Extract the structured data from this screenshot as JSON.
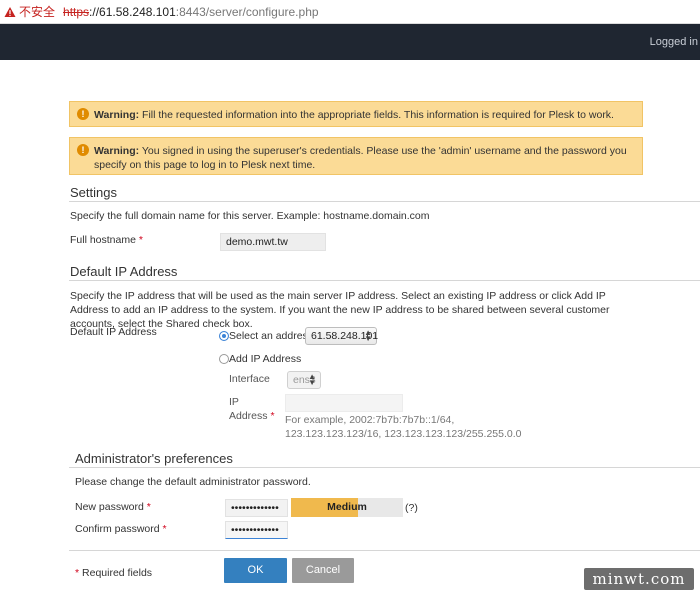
{
  "browser": {
    "insecure_label": "不安全",
    "url_scheme": "https",
    "url_host": "://61.58.248.101",
    "url_path": ":8443/server/configure.php"
  },
  "header": {
    "logged_in": "Logged in"
  },
  "warnings": [
    {
      "label": "Warning:",
      "text": " Fill the requested information into the appropriate fields. This information is required for Plesk to work."
    },
    {
      "label": "Warning:",
      "text": " You signed in using the superuser's credentials. Please use the 'admin' username and the password you specify on this page to log in to Plesk next time."
    }
  ],
  "settings": {
    "title": "Settings",
    "desc": "Specify the full domain name for this server. Example: hostname.domain.com",
    "hostname_label": "Full hostname",
    "hostname_value": "demo.mwt.tw",
    "required_mark": "*"
  },
  "ip": {
    "title": "Default IP Address",
    "desc": "Specify the IP address that will be used as the main server IP address. Select an existing IP address or click Add IP Address to add an IP address to the system. If you want the new IP address to be shared between several customer accounts, select the Shared check box.",
    "label": "Default IP Address",
    "select_label": "Select an address",
    "select_value": "61.58.248.101",
    "add_label": "Add IP Address",
    "interface_label": "Interface",
    "interface_value": "ens3",
    "ip_label_1": "IP",
    "ip_label_2": "Address",
    "ip_hint": "For example, 2002:7b7b:7b7b::1/64, 123.123.123.123/16, 123.123.123.123/255.255.0.0",
    "selected_option": "select"
  },
  "admin": {
    "title": "Administrator's preferences",
    "desc": "Please change the default administrator password.",
    "new_password_label": "New password",
    "new_password_value": "•••••••••••••",
    "confirm_password_label": "Confirm password",
    "confirm_password_value": "•••••••••••••",
    "strength_label": "Medium",
    "strength_fraction": 0.6,
    "help": "(?)"
  },
  "footer": {
    "required_fields": "Required fields",
    "ok": "OK",
    "cancel": "Cancel"
  },
  "watermark": "minwt.com",
  "colors": {
    "warning_bg": "#fbdb96",
    "primary": "#3480bf",
    "header_bg": "#1f2631"
  }
}
